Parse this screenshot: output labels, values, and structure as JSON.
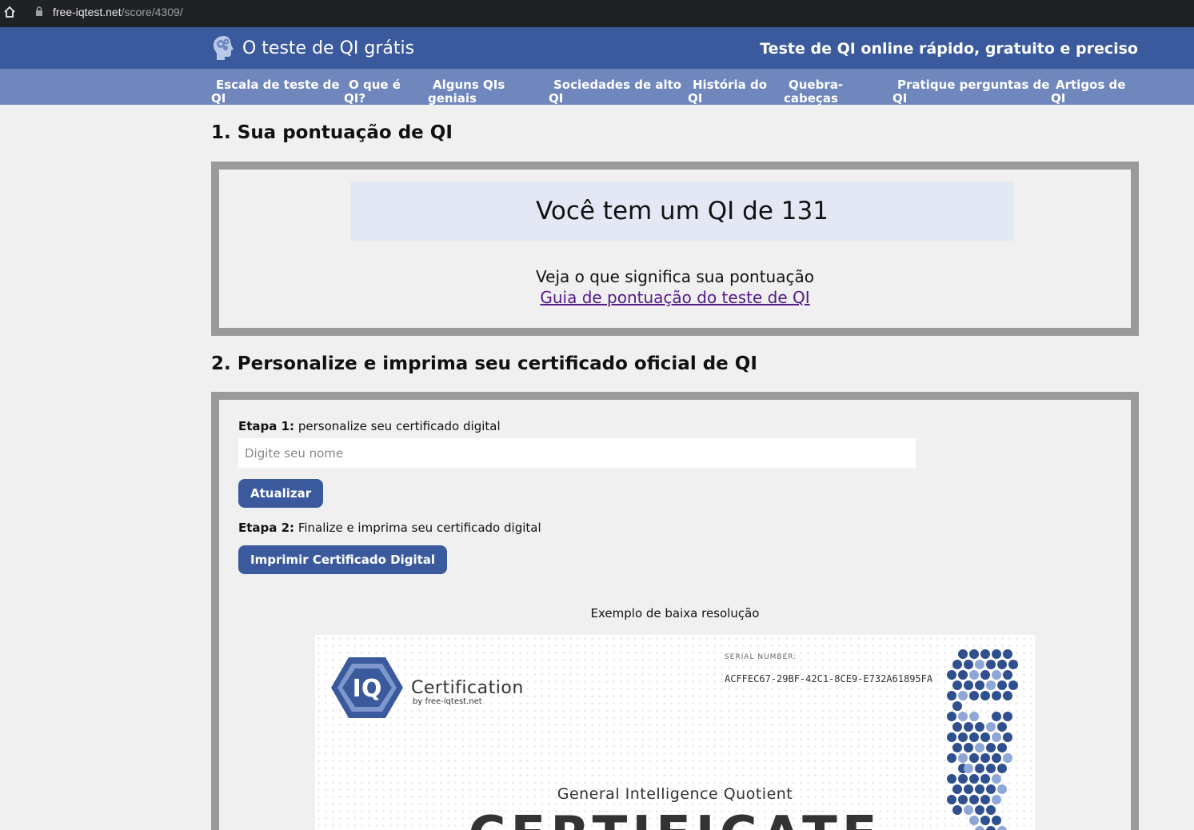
{
  "browser": {
    "url_host": "free-iqtest.net",
    "url_path": "/score/4309/"
  },
  "header": {
    "site_title": "O teste de QI grátis",
    "tagline": "Teste de QI online rápido, gratuito e preciso"
  },
  "nav": {
    "items": [
      {
        "line1": "Escala de teste de",
        "line2": "QI"
      },
      {
        "line1": "O que é",
        "line2": "QI?"
      },
      {
        "line1": "Alguns QIs",
        "line2": "geniais"
      },
      {
        "line1": "Sociedades de alto",
        "line2": "QI"
      },
      {
        "line1": "História do",
        "line2": "QI"
      },
      {
        "line1": "Quebra-",
        "line2": "cabeças"
      },
      {
        "line1": "Pratique perguntas de",
        "line2": "QI"
      },
      {
        "line1": "Artigos de",
        "line2": "QI"
      }
    ]
  },
  "section1": {
    "title": "1. Sua pontuação de QI",
    "score_text": "Você tem um QI de 131",
    "subtitle": "Veja o que significa sua pontuação",
    "link_text": "Guia de pontuação do teste de QI"
  },
  "section2": {
    "title": "2. Personalize e imprima seu certificado oficial de QI",
    "step1_bold": "Etapa 1:",
    "step1_text": " personalize seu certificado digital",
    "name_placeholder": "Digite seu nome",
    "update_button": "Atualizar",
    "step2_bold": "Etapa 2:",
    "step2_text": " Finalize e imprima seu certificado digital",
    "print_button": "Imprimir Certificado Digital",
    "caption": "Exemplo de baixa resolução"
  },
  "certificate": {
    "logo_text": "IQ",
    "brand": "Certification",
    "brand_by": "by free-iqtest.net",
    "serial_label": "SERIAL NUMBER:",
    "serial": "ACFFEC67-29BF-42C1-8CE9-E732A61895FA",
    "gen_title": "General Intelligence Quotient",
    "big_title": "CERTIFICATE"
  },
  "colors": {
    "header_bg": "#3b5a9d",
    "nav_bg": "#6f87bd",
    "button_bg": "#3b5a9d",
    "link": "#551a8b",
    "box_border": "#9a9a9a"
  }
}
